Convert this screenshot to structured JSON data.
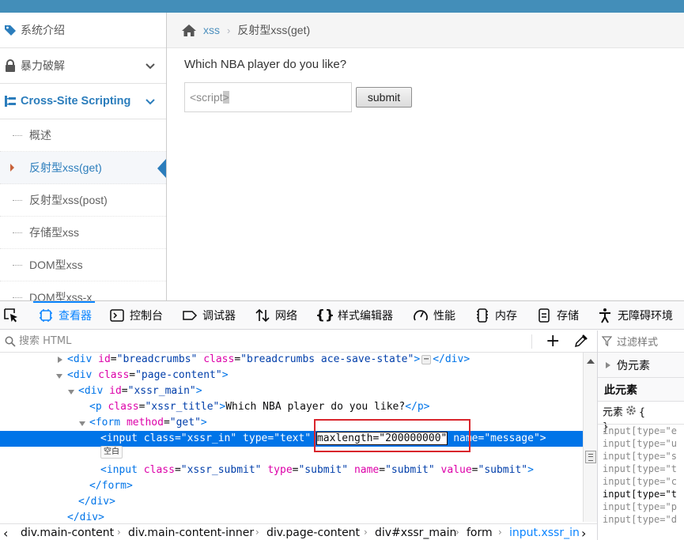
{
  "app": {
    "sidebar": {
      "items": [
        {
          "label": "系统介绍",
          "icon": "tag-icon"
        },
        {
          "label": "暴力破解",
          "icon": "lock-icon"
        },
        {
          "label": "Cross-Site Scripting",
          "icon": "sitemap-icon"
        }
      ],
      "subitems": [
        "概述",
        "反射型xss(get)",
        "反射型xss(post)",
        "存储型xss",
        "DOM型xss",
        "DOM型xss-x"
      ]
    },
    "breadcrumb": {
      "link": "xss",
      "current": "反射型xss(get)"
    },
    "form": {
      "question": "Which NBA player do you like?",
      "input_value_plain": "<script",
      "input_value_selected": ">",
      "submit_label": "submit"
    }
  },
  "devtools": {
    "tabs": [
      "查看器",
      "控制台",
      "调试器",
      "网络",
      "样式编辑器",
      "性能",
      "内存",
      "存储",
      "无障碍环境"
    ],
    "search_placeholder": "搜索 HTML",
    "markup": {
      "r0": {
        "open": "<div ",
        "a1": "id",
        "v1": "\"breadcrumbs\"",
        "a2": "class",
        "v2": "\"breadcrumbs ace-save-state\"",
        "gt": ">",
        "ell": "⋯",
        "close": "</div>"
      },
      "r1": {
        "open": "<div ",
        "a1": "class",
        "v1": "\"page-content\"",
        "gt": ">"
      },
      "r2": {
        "open": "<div ",
        "a1": "id",
        "v1": "\"xssr_main\"",
        "gt": ">"
      },
      "r3": {
        "open": "<p ",
        "a1": "class",
        "v1": "\"xssr_title\"",
        "gt": ">",
        "text": "Which NBA player do you like?",
        "close": "</p>"
      },
      "r4": {
        "open": "<form ",
        "a1": "method",
        "v1": "\"get\"",
        "gt": ">"
      },
      "r5": {
        "open": "<input ",
        "a1": "class",
        "v1": "\"xssr_in\"",
        "a2": "type",
        "v2": "\"text\"",
        "a3": "maxlength",
        "v3": "\"200000000\"",
        "a4": "name",
        "v4": "\"message\"",
        "gt": ">"
      },
      "r6": {
        "badge": "空白"
      },
      "r7": {
        "open": "<input ",
        "a1": "class",
        "v1": "\"xssr_submit\"",
        "a2": "type",
        "v2": "\"submit\"",
        "a3": "name",
        "v3": "\"submit\"",
        "a4": "value",
        "v4": "\"submit\"",
        "gt": ">"
      },
      "r8": {
        "close": "</form>"
      },
      "r9": {
        "close": "</div>"
      },
      "r10": {
        "close": "</div>"
      }
    },
    "breadcrumbs": [
      "div.main-content",
      "div.main-content-inner",
      "div.page-content",
      "div#xssr_main",
      "form",
      "input.xssr_in"
    ],
    "rules_panel": {
      "filter_placeholder": "过滤样式",
      "pseudo": "伪元素",
      "this_element": "此元素",
      "element_label": "元素",
      "brace_open": "{",
      "brace_close": "}",
      "selectors": [
        "input[type=\"e",
        "input[type=\"u",
        "input[type=\"s",
        "input[type=\"t",
        "input[type=\"c",
        "input[type=\"t",
        "input[type=\"p",
        "input[type=\"d"
      ]
    }
  },
  "colors": {
    "accent": "#0a84ff",
    "selection": "#0074e8",
    "sidebar_active": "#2b7dbc",
    "topbar": "#438eb9",
    "annotation": "#d9252c"
  }
}
